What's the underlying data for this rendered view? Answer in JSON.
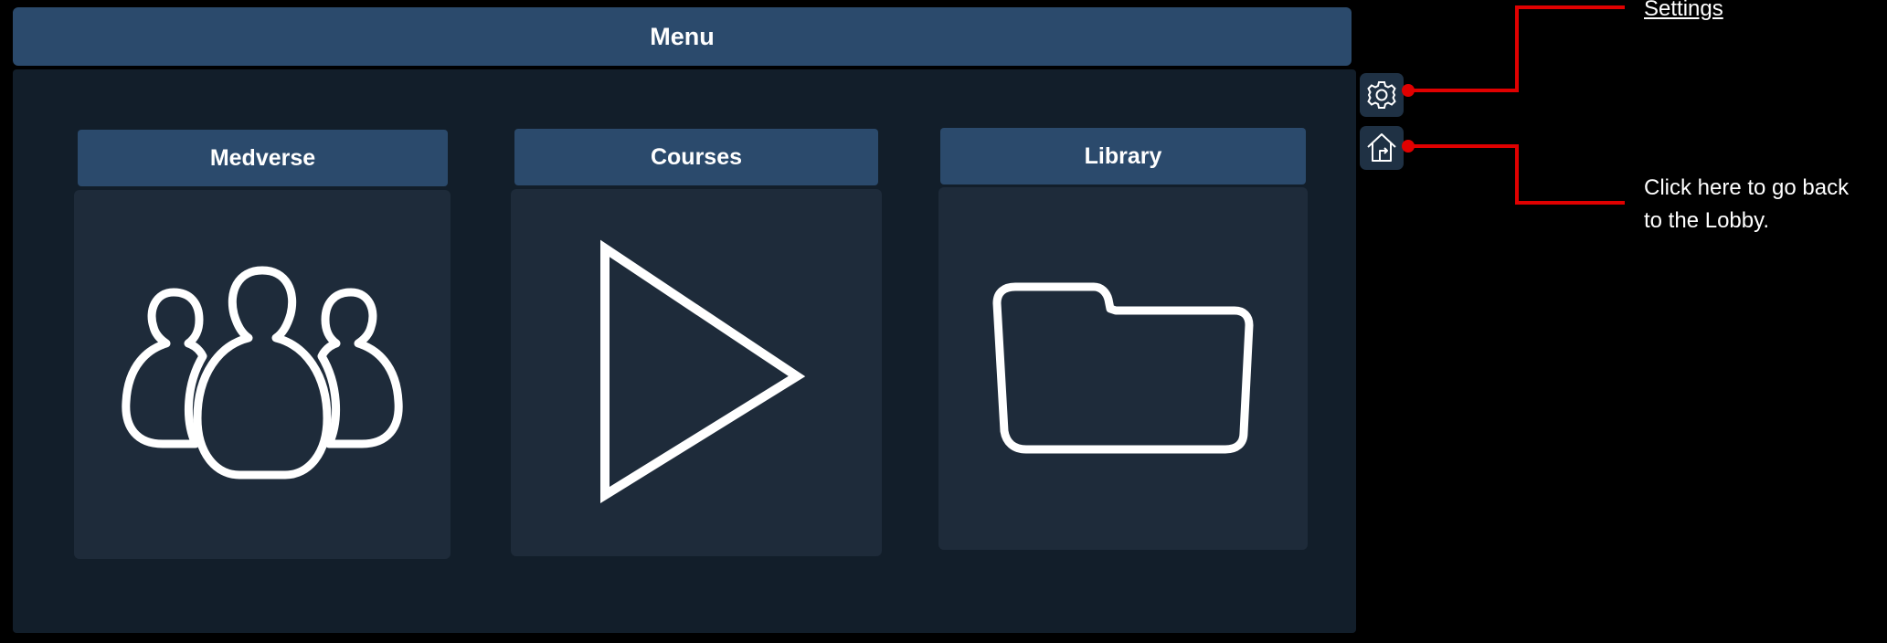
{
  "menu": {
    "title": "Menu",
    "cards": [
      {
        "label": "Medverse",
        "icon": "people-group-icon"
      },
      {
        "label": "Courses",
        "icon": "play-icon"
      },
      {
        "label": "Library",
        "icon": "folder-icon"
      }
    ]
  },
  "side_buttons": [
    {
      "icon": "gear-icon"
    },
    {
      "icon": "home-back-icon"
    }
  ],
  "annotations": {
    "settings": "Settings",
    "lobby_line1": "Click here to go back",
    "lobby_line2": "to the Lobby."
  },
  "colors": {
    "background": "#000000",
    "panel_header": "#2b4a6c",
    "panel_body": "#121e2a",
    "card_body": "#1e2b3a",
    "callout": "#e00000",
    "icon_stroke": "#ffffff"
  }
}
